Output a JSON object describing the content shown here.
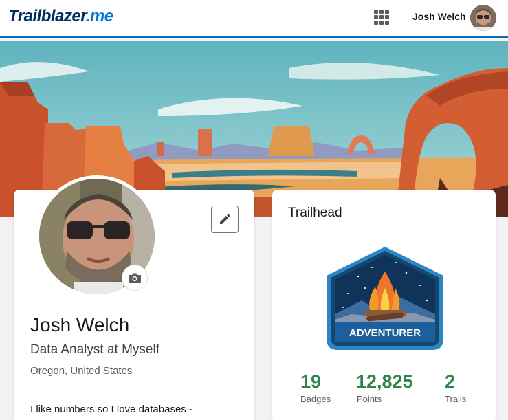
{
  "header": {
    "logo_text": "Trailblazer",
    "logo_suffix": ".me",
    "user_name": "Josh Welch"
  },
  "profile": {
    "name": "Josh Welch",
    "title": "Data Analyst at Myself",
    "location": "Oregon, United States",
    "bio": "I like numbers so I love databases -"
  },
  "trailhead": {
    "heading": "Trailhead",
    "rank_badge": "ADVENTURER",
    "stats": [
      {
        "value": "19",
        "label": "Badges"
      },
      {
        "value": "12,825",
        "label": "Points"
      },
      {
        "value": "2",
        "label": "Trails"
      }
    ]
  },
  "colors": {
    "accent_blue": "#0b6cba",
    "stat_green": "#2e844a",
    "badge_blue": "#1b5f9e"
  },
  "icons": [
    "app-launcher-icon",
    "camera-icon",
    "pencil-icon",
    "campfire-icon"
  ]
}
